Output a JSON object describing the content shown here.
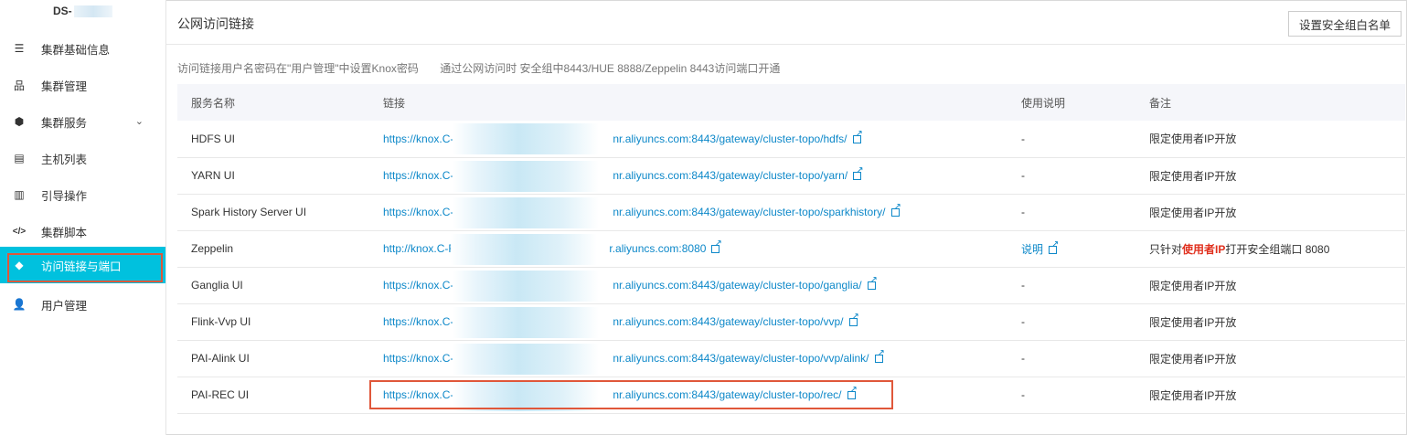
{
  "sidebar": {
    "cluster_prefix": "DS-",
    "items": [
      {
        "label": "集群基础信息",
        "icon": "list-icon"
      },
      {
        "label": "集群管理",
        "icon": "sitemap-icon"
      },
      {
        "label": "集群服务",
        "icon": "cube-icon",
        "expandable": true
      },
      {
        "label": "主机列表",
        "icon": "server-icon"
      },
      {
        "label": "引导操作",
        "icon": "document-icon"
      },
      {
        "label": "集群脚本",
        "icon": "code-icon"
      },
      {
        "label": "访问链接与端口",
        "icon": "tag-icon",
        "active": true
      },
      {
        "label": "用户管理",
        "icon": "user-gear-icon"
      }
    ]
  },
  "header": {
    "title": "公网访问链接",
    "security_button": "设置安全组白名单"
  },
  "notice": {
    "line1": "访问链接用户名密码在\"用户管理\"中设置Knox密码",
    "line2": "通过公网访问时 安全组中8443/HUE 8888/Zeppelin  8443访问端口开通"
  },
  "table": {
    "headers": [
      "服务名称",
      "链接",
      "使用说明",
      "备注"
    ],
    "rows": [
      {
        "service": "HDFS UI",
        "link_prefix": "https://knox.C-F9",
        "link_suffix": "nr.aliyuncs.com:8443/gateway/cluster-topo/hdfs/",
        "usage": "-",
        "note": "限定使用者IP开放"
      },
      {
        "service": "YARN UI",
        "link_prefix": "https://knox.C-F9",
        "link_suffix": "nr.aliyuncs.com:8443/gateway/cluster-topo/yarn/",
        "usage": "-",
        "note": "限定使用者IP开放"
      },
      {
        "service": "Spark History Server UI",
        "link_prefix": "https://knox.C-F9",
        "link_suffix": "nr.aliyuncs.com:8443/gateway/cluster-topo/sparkhistory/",
        "usage": "-",
        "note": "限定使用者IP开放"
      },
      {
        "service": "Zeppelin",
        "link_prefix": "http://knox.C-F9",
        "link_suffix": "r.aliyuncs.com:8080",
        "usage": "说明",
        "usage_is_link": true,
        "note_parts": [
          "只针对",
          "使用者IP",
          "打开安全组端口 8080"
        ]
      },
      {
        "service": "Ganglia UI",
        "link_prefix": "https://knox.C-F9",
        "link_suffix": "nr.aliyuncs.com:8443/gateway/cluster-topo/ganglia/",
        "usage": "-",
        "note": "限定使用者IP开放"
      },
      {
        "service": "Flink-Vvp UI",
        "link_prefix": "https://knox.C-F9",
        "link_suffix": "nr.aliyuncs.com:8443/gateway/cluster-topo/vvp/",
        "usage": "-",
        "note": "限定使用者IP开放"
      },
      {
        "service": "PAI-Alink UI",
        "link_prefix": "https://knox.C-F9",
        "link_suffix": "nr.aliyuncs.com:8443/gateway/cluster-topo/vvp/alink/",
        "usage": "-",
        "note": "限定使用者IP开放"
      },
      {
        "service": "PAI-REC UI",
        "link_prefix": "https://knox.C-F9",
        "link_suffix": "nr.aliyuncs.com:8443/gateway/cluster-topo/rec/",
        "usage": "-",
        "note": "限定使用者IP开放"
      }
    ]
  },
  "colors": {
    "accent": "#00c1de",
    "link": "#0d88c9",
    "highlight_box": "#e0573a",
    "warning_text": "#e0301e"
  }
}
